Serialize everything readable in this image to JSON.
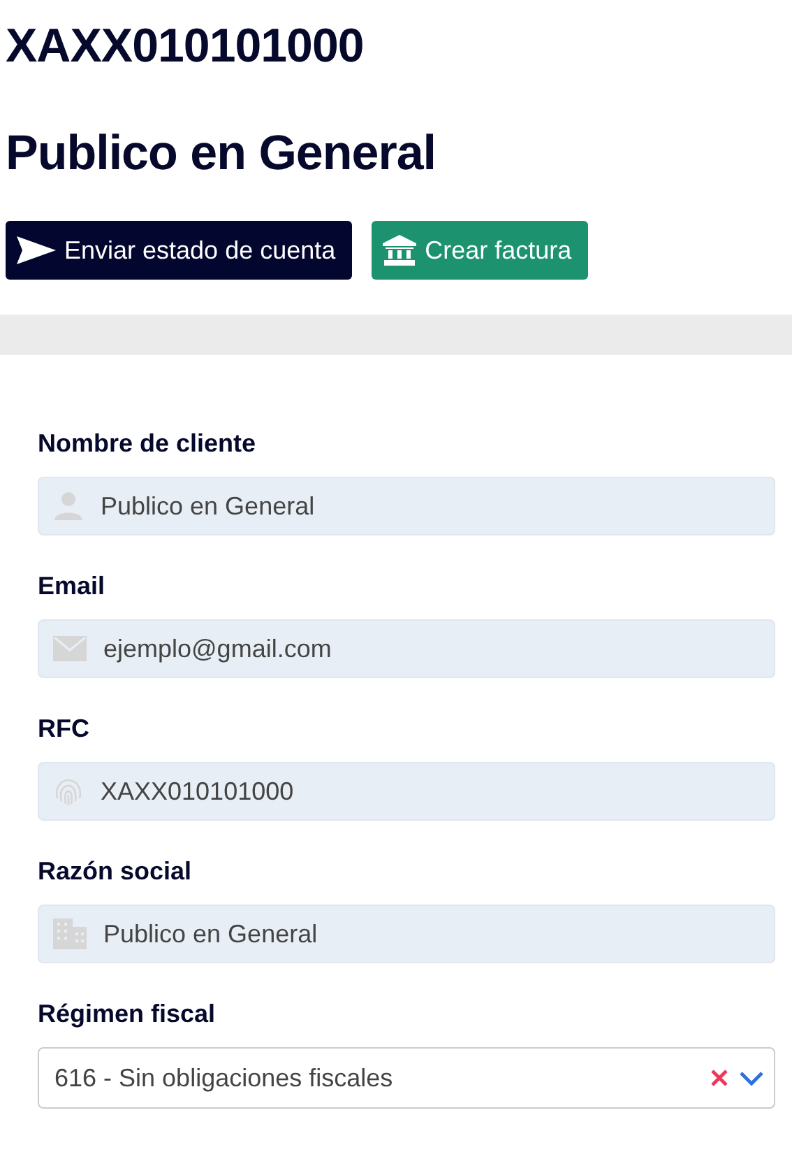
{
  "title": "XAXX010101000",
  "subtitle": "Publico en General",
  "buttons": [
    {
      "label": "Enviar estado de cuenta",
      "kind": "send"
    },
    {
      "label": "Crear factura",
      "kind": "invoice"
    }
  ],
  "fields": [
    {
      "label": "Nombre de cliente",
      "kind": "person",
      "value": "Publico en General"
    },
    {
      "label": "Email",
      "kind": "mail",
      "value": "ejemplo@gmail.com"
    },
    {
      "label": "RFC",
      "kind": "fingerprint",
      "value": "XAXX010101000"
    },
    {
      "label": "Razón social",
      "kind": "building",
      "value": "Publico en General"
    },
    {
      "label": "Régimen fiscal",
      "kind": "select",
      "value": "616 - Sin obligaciones fiscales"
    }
  ]
}
